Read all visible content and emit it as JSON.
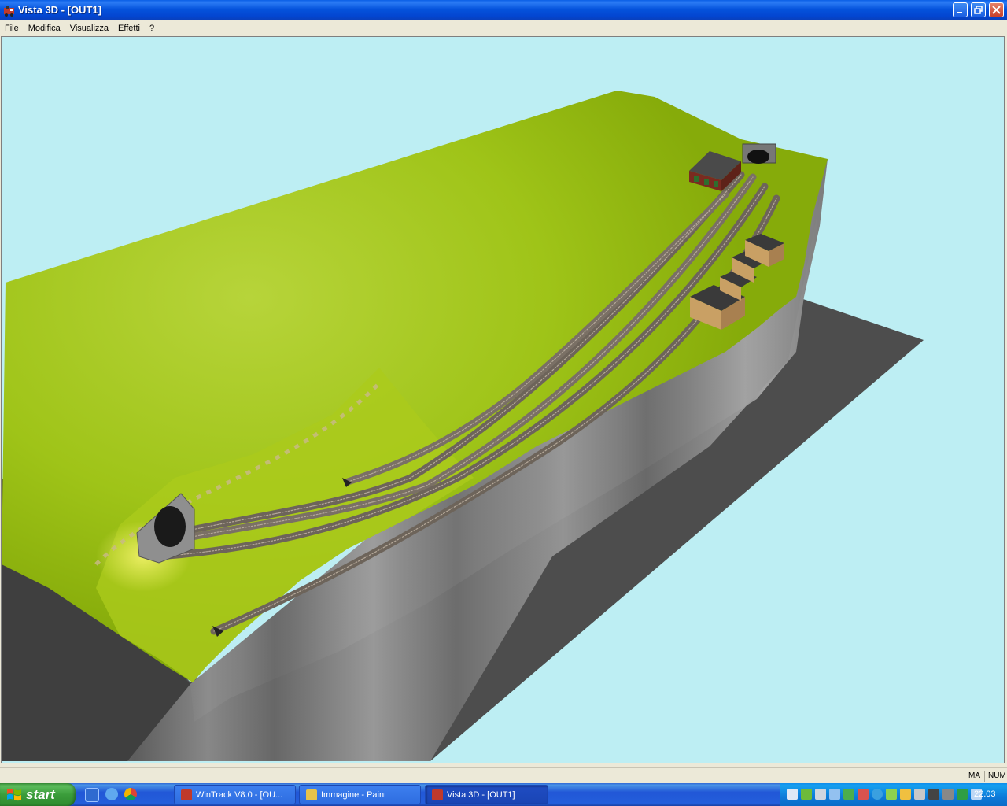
{
  "window": {
    "title": "Vista 3D - [OUT1]"
  },
  "menu": [
    "File",
    "Modifica",
    "Visualizza",
    "Effetti",
    "?"
  ],
  "status": {
    "ma": "MA",
    "num": "NUM"
  },
  "taskbar": {
    "start_label": "start",
    "tasks": [
      {
        "label": "WinTrack  V8.0 - [OU...",
        "active": false
      },
      {
        "label": "Immagine - Paint",
        "active": false
      },
      {
        "label": "Vista 3D - [OUT1]",
        "active": true
      }
    ],
    "clock": "22.03"
  },
  "scene": {
    "sky_color": "#bdeef3",
    "grass_color": "#9dc412",
    "cliff_color": "#8a8a8a",
    "shadow_color": "#4d4d4d"
  }
}
